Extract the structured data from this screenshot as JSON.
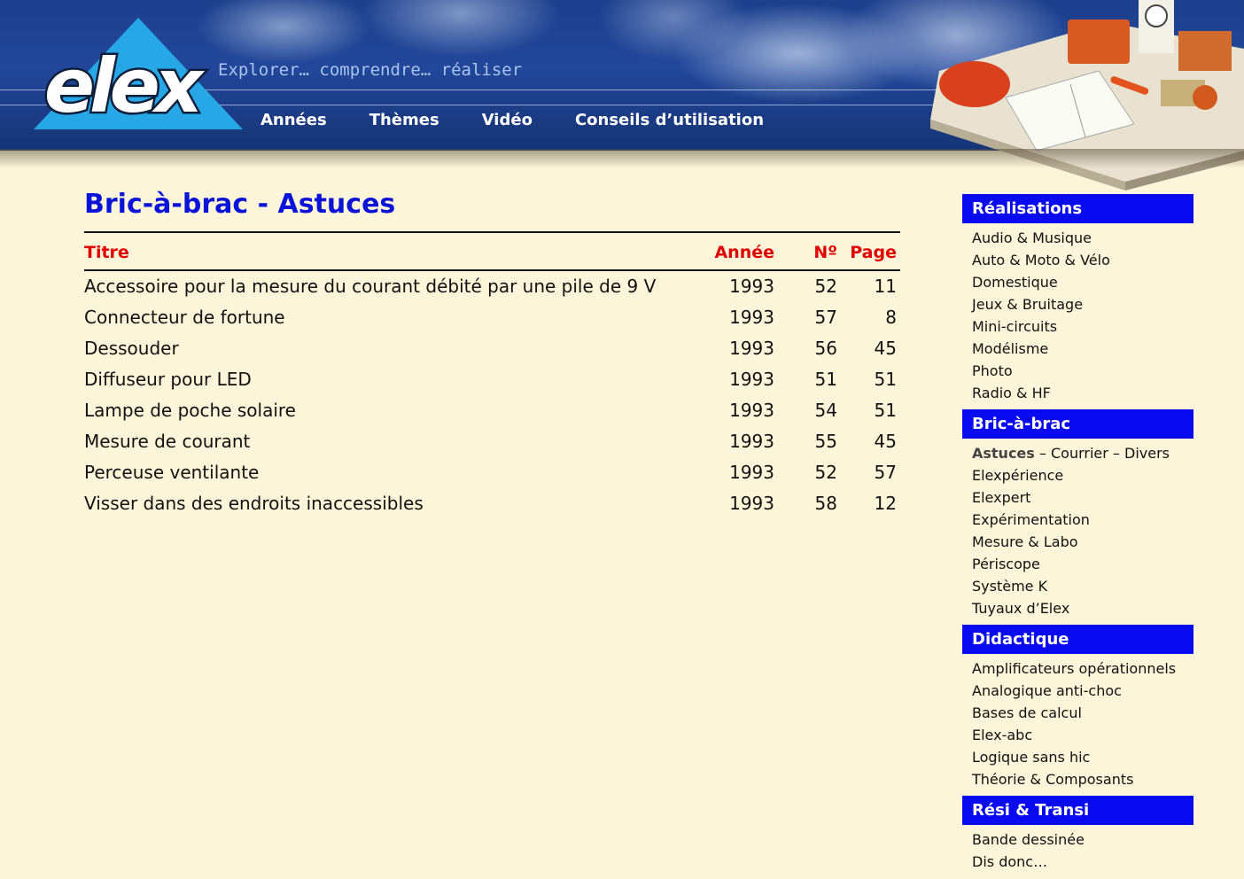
{
  "header": {
    "logo_text": "elex",
    "tagline": "Explorer… comprendre… réaliser",
    "nav": [
      "Années",
      "Thèmes",
      "Vidéo",
      "Conseils d’utilisation"
    ]
  },
  "main": {
    "title": "Bric-à-brac - Astuces",
    "columns": {
      "title": "Titre",
      "year": "Année",
      "no": "Nº",
      "page": "Page"
    },
    "rows": [
      {
        "title": "Accessoire pour la mesure du courant débité par une pile de 9 V",
        "year": "1993",
        "no": "52",
        "page": "11"
      },
      {
        "title": "Connecteur de fortune",
        "year": "1993",
        "no": "57",
        "page": "8"
      },
      {
        "title": "Dessouder",
        "year": "1993",
        "no": "56",
        "page": "45"
      },
      {
        "title": "Diffuseur pour LED",
        "year": "1993",
        "no": "51",
        "page": "51"
      },
      {
        "title": "Lampe de poche solaire",
        "year": "1993",
        "no": "54",
        "page": "51"
      },
      {
        "title": "Mesure de courant",
        "year": "1993",
        "no": "55",
        "page": "45"
      },
      {
        "title": "Perceuse ventilante",
        "year": "1993",
        "no": "52",
        "page": "57"
      },
      {
        "title": "Visser dans des endroits inaccessibles",
        "year": "1993",
        "no": "58",
        "page": "12"
      }
    ]
  },
  "sidebar": {
    "sections": [
      {
        "heading": "Réalisations",
        "items": [
          "Audio & Musique",
          "Auto & Moto & Vélo",
          "Domestique",
          "Jeux & Bruitage",
          "Mini-circuits",
          "Modélisme",
          "Photo",
          "Radio & HF"
        ]
      },
      {
        "heading": "Bric-à-brac",
        "current": "Astuces",
        "dash1": " – ",
        "link1": "Courrier",
        "dash2": " – ",
        "link2": "Divers",
        "items": [
          "Elexpérience",
          "Elexpert",
          "Expérimentation",
          "Mesure & Labo",
          "Périscope",
          "Système K",
          "Tuyaux d’Elex"
        ]
      },
      {
        "heading": "Didactique",
        "items": [
          "Amplificateurs opérationnels",
          "Analogique anti-choc",
          "Bases de calcul",
          "Elex-abc",
          "Logique sans hic",
          "Théorie & Composants"
        ]
      },
      {
        "heading": "Rési & Transi",
        "items": [
          "Bande dessinée",
          "Dis donc…"
        ]
      }
    ]
  },
  "colors": {
    "accent_blue": "#0a14d8",
    "header_red": "#e00000",
    "section_blue": "#0a0af0",
    "background": "#fdf5da"
  }
}
